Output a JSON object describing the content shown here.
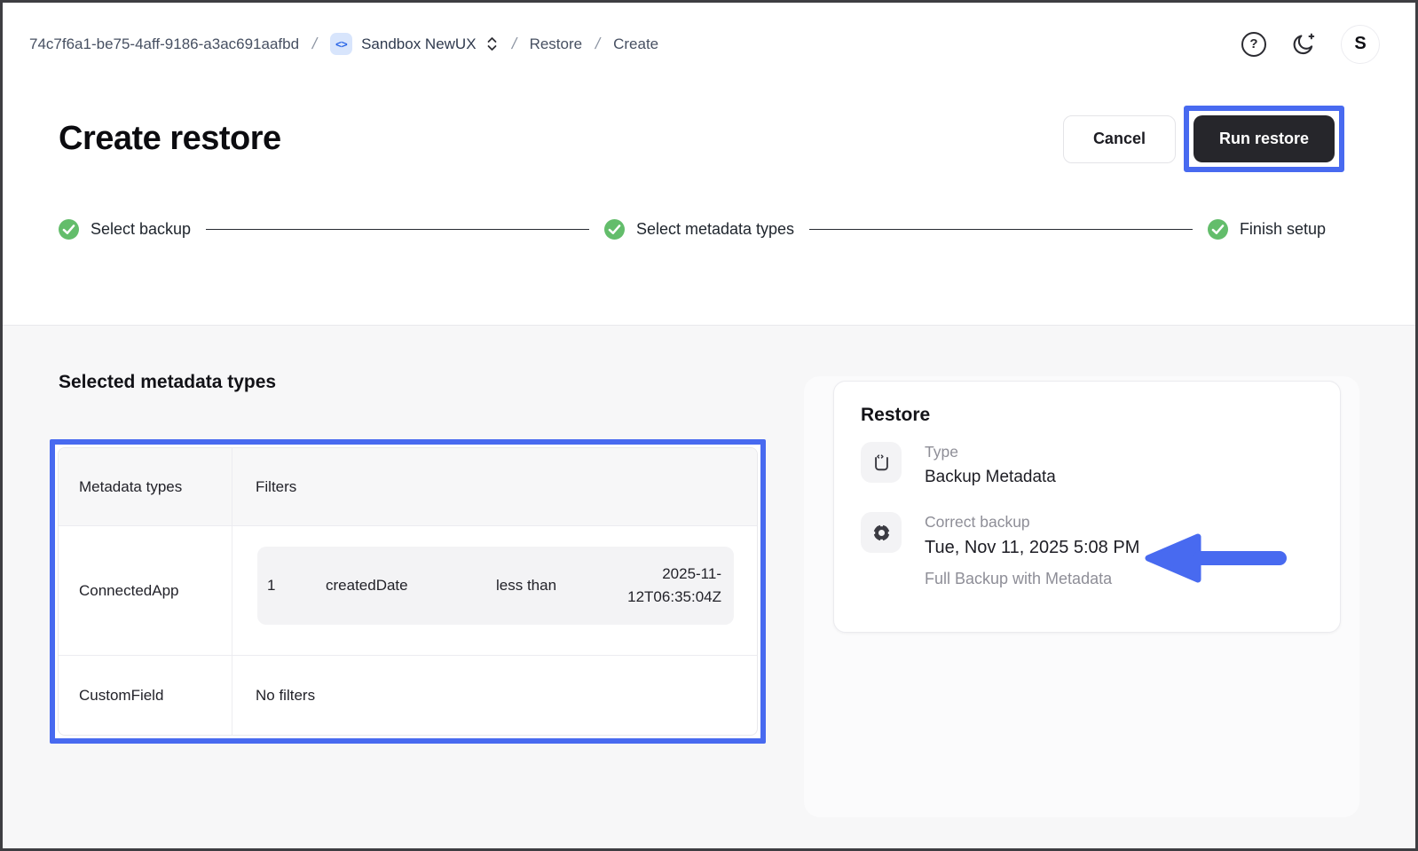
{
  "breadcrumb": {
    "org_id": "74c7f6a1-be75-4aff-9186-a3ac691aafbd",
    "sep": "/",
    "env_icon": "<>",
    "env_name": "Sandbox NewUX",
    "restore": "Restore",
    "create": "Create"
  },
  "topbar": {
    "help_glyph": "?",
    "avatar_initial": "S"
  },
  "header": {
    "title": "Create restore",
    "cancel": "Cancel",
    "run": "Run restore"
  },
  "stepper": {
    "steps": [
      {
        "label": "Select backup",
        "state": "complete"
      },
      {
        "label": "Select metadata types",
        "state": "complete"
      },
      {
        "label": "Finish setup",
        "state": "complete"
      }
    ]
  },
  "metadata": {
    "section_title": "Selected metadata types",
    "columns": {
      "types": "Metadata types",
      "filters": "Filters"
    },
    "rows": [
      {
        "type": "ConnectedApp",
        "filter": {
          "index": "1",
          "field": "createdDate",
          "operator": "less than",
          "value": "2025-11-12T06:35:04Z"
        }
      },
      {
        "type": "CustomField",
        "filters_text": "No filters"
      }
    ]
  },
  "summary": {
    "title": "Restore",
    "type_label": "Type",
    "type_value": "Backup Metadata",
    "backup_label": "Correct backup",
    "backup_value": "Tue, Nov 11, 2025 5:08 PM",
    "backup_detail": "Full Backup with Metadata"
  },
  "colors": {
    "annotation_highlight": "#486af0",
    "step_success_green": "#63bd6b",
    "primary_button_dark": "#26262b",
    "env_chip_bg": "#d8e5fc",
    "env_chip_text": "#2764e6"
  }
}
